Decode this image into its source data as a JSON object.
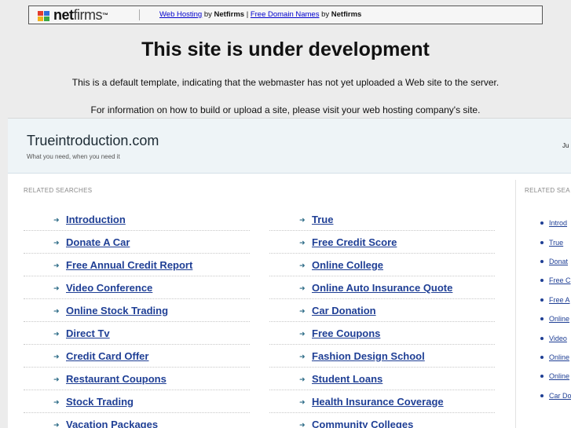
{
  "banner": {
    "logo_bold": "net",
    "logo_rest": "firms",
    "logo_tm": "™",
    "link1": "Web Hosting",
    "by1": " by ",
    "brand1": "Netfirms",
    "sep": " | ",
    "link2": "Free Domain Names",
    "by2": " by ",
    "brand2": "Netfirms"
  },
  "headline": "This site is under development",
  "notice1": "This is a default template, indicating that the webmaster has not yet uploaded a Web site to the server.",
  "notice2": "For information on how to build or upload a site, please visit your web hosting company's site.",
  "site": {
    "title": "Trueintroduction.com",
    "tagline": "What you need, when you need it",
    "header_right": "Ju"
  },
  "related": {
    "label": "RELATED SEARCHES",
    "side_label": "RELATED SEA",
    "col1": [
      "Introduction",
      "Donate A Car",
      "Free Annual Credit Report",
      "Video Conference",
      "Online Stock Trading",
      "Direct Tv",
      "Credit Card Offer",
      "Restaurant Coupons",
      "Stock Trading",
      "Vacation Packages"
    ],
    "col2": [
      "True",
      "Free Credit Score",
      "Online College",
      "Online Auto Insurance Quote",
      "Car Donation",
      "Free Coupons",
      "Fashion Design School",
      "Student Loans",
      "Health Insurance Coverage",
      "Community Colleges"
    ],
    "side": [
      "Introd",
      "True",
      "Donat",
      "Free C",
      "Free A",
      "Online",
      "Video",
      "Online",
      "Online",
      "Car Do"
    ]
  }
}
